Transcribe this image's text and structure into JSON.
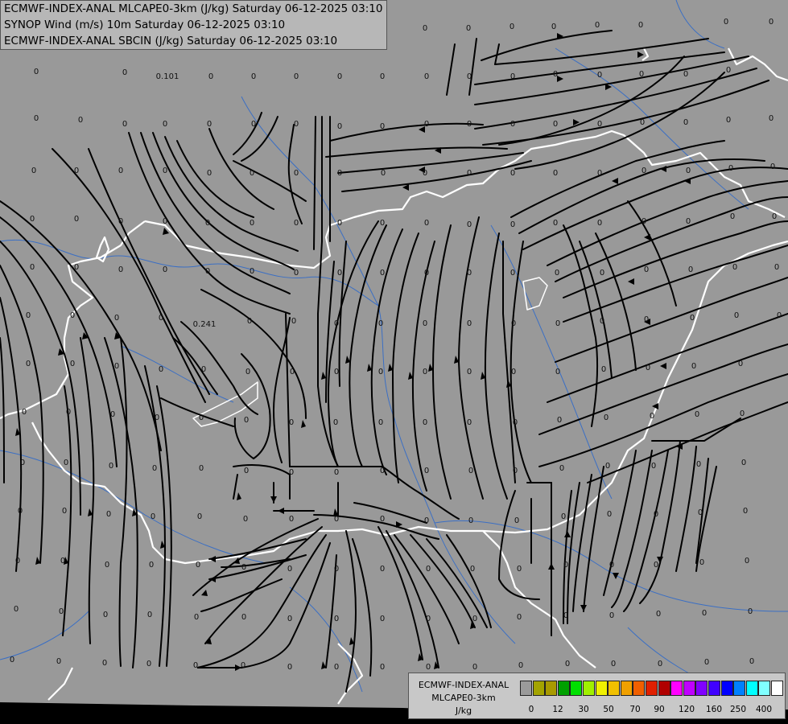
{
  "header": {
    "line1": "ECMWF-INDEX-ANAL MLCAPE0-3km (J/kg) Saturday 06-12-2025 03:10",
    "line2": "SYNOP Wind (m/s) 10m Saturday 06-12-2025 03:10",
    "line3": "ECMWF-INDEX-ANAL SBCIN (J/kg) Saturday 06-12-2025 03:10"
  },
  "legend": {
    "line1": "ECMWF-INDEX-ANAL",
    "line2": "MLCAPE0-3km",
    "line3": "J/kg",
    "tick_labels": [
      "0",
      "12",
      "30",
      "50",
      "70",
      "90",
      "120",
      "160",
      "250",
      "400"
    ],
    "colors": [
      "#9a9a9a",
      "#a3a300",
      "#a89a00",
      "#00a000",
      "#00e000",
      "#a0f000",
      "#f0f000",
      "#f0c000",
      "#f0a000",
      "#f06000",
      "#e02000",
      "#b00000",
      "#ff00ff",
      "#c000ff",
      "#8000ff",
      "#4000ff",
      "#0000ff",
      "#0080ff",
      "#00ffff",
      "#80ffff",
      "#ffffff"
    ]
  },
  "map_values": {
    "special_1": "0.101",
    "special_2": "0.241",
    "cin_zero": "0"
  },
  "colors": {
    "background": "#999999",
    "border_white": "#ffffff",
    "river_blue": "#3b6fc4",
    "streamline": "#000000"
  }
}
